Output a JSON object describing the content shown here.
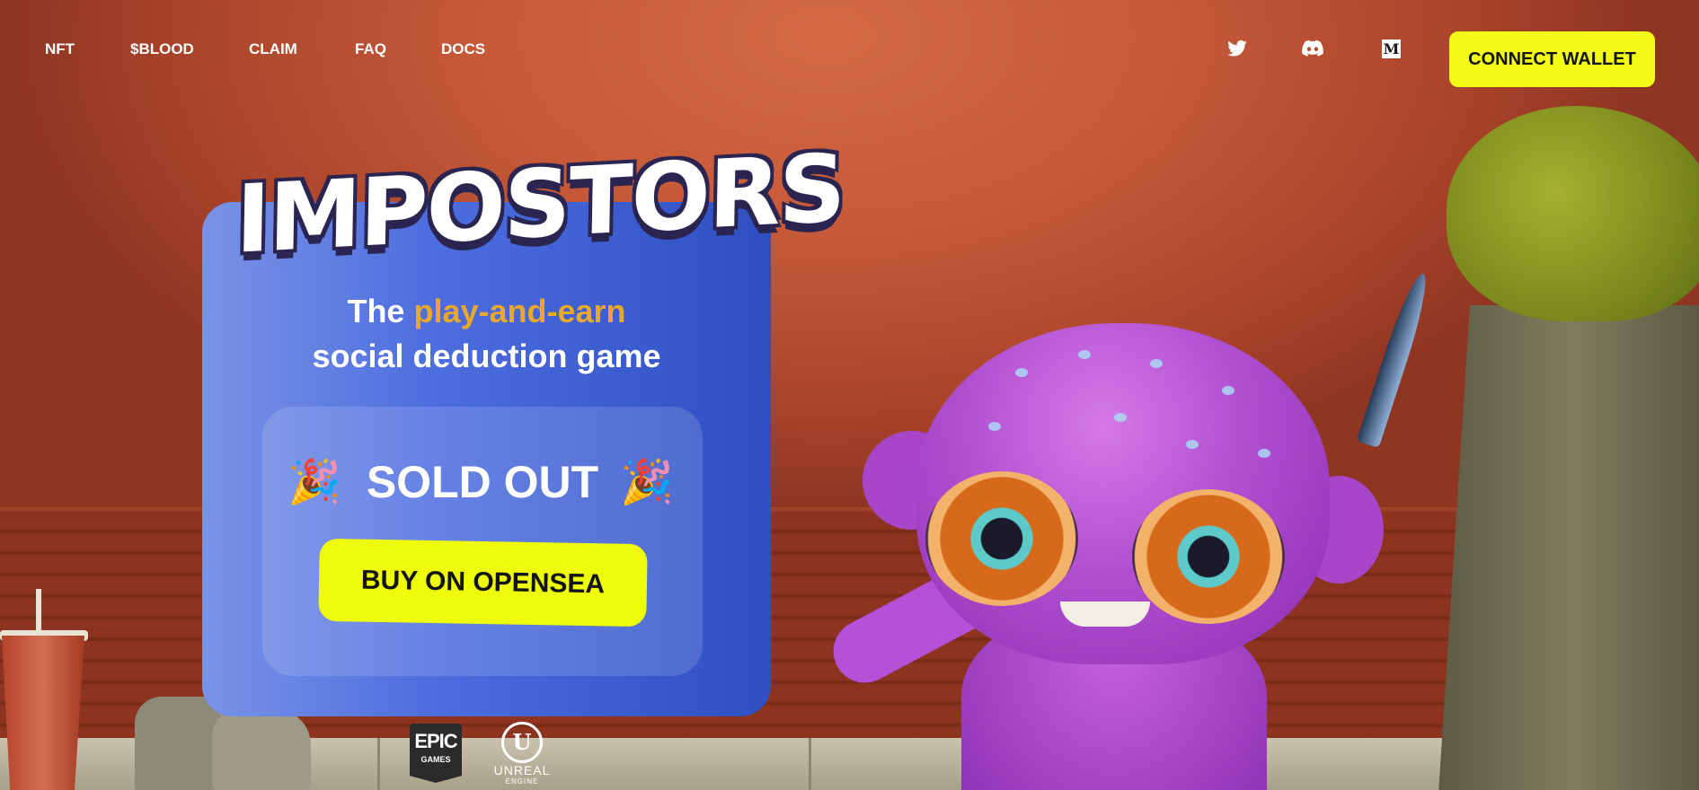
{
  "nav": {
    "links": [
      {
        "label": "NFT"
      },
      {
        "label": "$BLOOD"
      },
      {
        "label": "CLAIM"
      },
      {
        "label": "FAQ"
      },
      {
        "label": "DOCS"
      }
    ],
    "social": [
      {
        "icon": "twitter-icon"
      },
      {
        "icon": "discord-icon"
      },
      {
        "icon": "medium-icon",
        "glyph": "M"
      }
    ],
    "connect_label": "CONNECT WALLET"
  },
  "hero": {
    "logo_text": "IMPOSTORS",
    "tagline_prefix": "The ",
    "tagline_accent": "play-and-earn",
    "tagline_line2": "social deduction game",
    "status": "SOLD OUT",
    "party_emoji": "🎉",
    "cta_label": "BUY ON OPENSEA"
  },
  "partners": {
    "epic_line1": "EPIC",
    "epic_line2": "GAMES",
    "unreal_mark": "U",
    "unreal_line1": "UNREAL",
    "unreal_line2": "ENGINE"
  },
  "colors": {
    "accent_yellow": "#f2fc16",
    "card_blue": "#2d4fc2",
    "tagline_accent": "#e8a92a"
  }
}
